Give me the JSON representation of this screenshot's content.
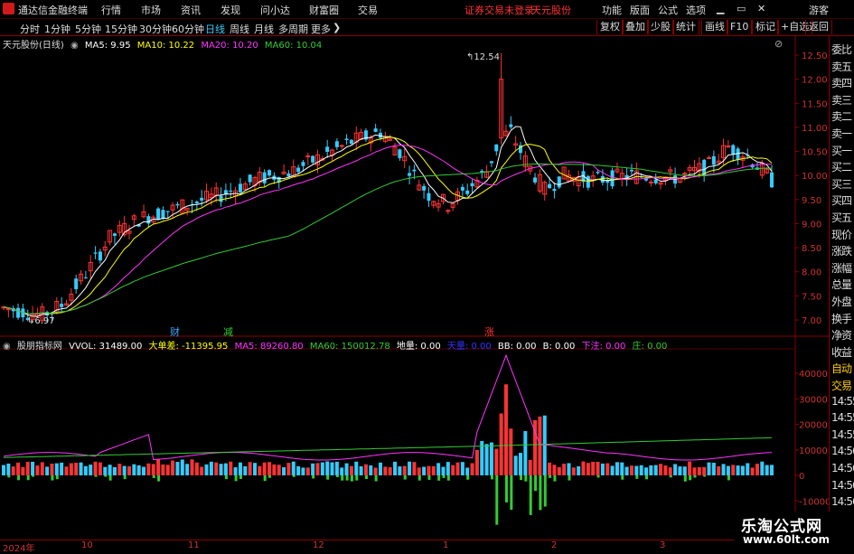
{
  "menubar": {
    "app_title": "通达信金融终端",
    "items": [
      "行情",
      "市场",
      "资讯",
      "发现",
      "问小达",
      "财富圈",
      "交易"
    ],
    "notice": "证券交易未登录",
    "stock": "天元股份",
    "right_items": [
      "功能",
      "版面",
      "公式",
      "选项"
    ],
    "guest": "游客",
    "window_buttons": [
      "▁",
      "▭",
      "✕"
    ]
  },
  "periodbar": {
    "periods": [
      "分时",
      "1分钟",
      "5分钟",
      "15分钟",
      "30分钟",
      "60分钟",
      "日线",
      "周线",
      "月线",
      "多周期",
      "更多"
    ],
    "active": "日线",
    "buttons": [
      "复权",
      "叠加",
      "少股",
      "统计",
      "画线",
      "F10",
      "标记",
      "+自选",
      "返回"
    ]
  },
  "kchart": {
    "title": "天元股份(日线)",
    "ma": [
      {
        "label": "MA5: 9.95",
        "color": "#ffffff"
      },
      {
        "label": "MA10: 10.22",
        "color": "#ffff00"
      },
      {
        "label": "MA20: 10.20",
        "color": "#ff33ff"
      },
      {
        "label": "MA60: 10.04",
        "color": "#33cc33"
      }
    ],
    "high_label": "12.54",
    "low_label": "6.97",
    "price_ticks": [
      "12.50",
      "12.00",
      "11.50",
      "11.00",
      "10.50",
      "10.00",
      "9.50",
      "9.00",
      "8.50",
      "8.00",
      "7.50",
      "7.00"
    ],
    "markers": [
      {
        "text": "财",
        "color": "#33aaff"
      },
      {
        "text": "减",
        "color": "#33cc33"
      },
      {
        "text": "涨",
        "color": "#ff3333"
      }
    ]
  },
  "indicator": {
    "name": "股朋指标网",
    "values": [
      {
        "label": "VVOL: 31489.00",
        "color": "#ffffff"
      },
      {
        "label": "大单差: -11395.95",
        "color": "#ffff00"
      },
      {
        "label": "MA5: 89260.80",
        "color": "#ff33ff"
      },
      {
        "label": "MA60: 150012.78",
        "color": "#33cc33"
      },
      {
        "label": "地量: 0.00",
        "color": "#ffffff"
      },
      {
        "label": "天量: 0.00",
        "color": "#3333ff"
      },
      {
        "label": "BB: 0.00",
        "color": "#ffffff"
      },
      {
        "label": "B: 0.00",
        "color": "#ffffff"
      },
      {
        "label": "下注: 0.00",
        "color": "#ff33ff"
      },
      {
        "label": "庄: 0.00",
        "color": "#33cc33"
      }
    ],
    "ticks": [
      "40000",
      "30000",
      "20000",
      "10000",
      "0",
      "-10000"
    ]
  },
  "timeaxis": [
    "2024年",
    "10",
    "11",
    "12",
    "1",
    "2",
    "3"
  ],
  "rightpanel": [
    "委比",
    "卖五",
    "卖四",
    "卖三",
    "卖二",
    "卖一",
    "买一",
    "买二",
    "买三",
    "买四",
    "买五",
    "现价",
    "涨跌",
    "涨幅",
    "总量",
    "外盘",
    "换手",
    "净资",
    "收益",
    "自动",
    "交易",
    "14:55",
    "14:55",
    "14:55",
    "14:56",
    "14:56",
    "14:56",
    "14:56",
    "14:56"
  ],
  "watermark": {
    "line1": "乐淘公式网",
    "line2": "www.60lt.com"
  },
  "colors": {
    "up": "#ff3333",
    "down": "#33ccff",
    "grid": "#880000",
    "ma5": "#ffffff",
    "ma10": "#ffff00",
    "ma20": "#ff33ff",
    "ma60": "#33cc33"
  }
}
